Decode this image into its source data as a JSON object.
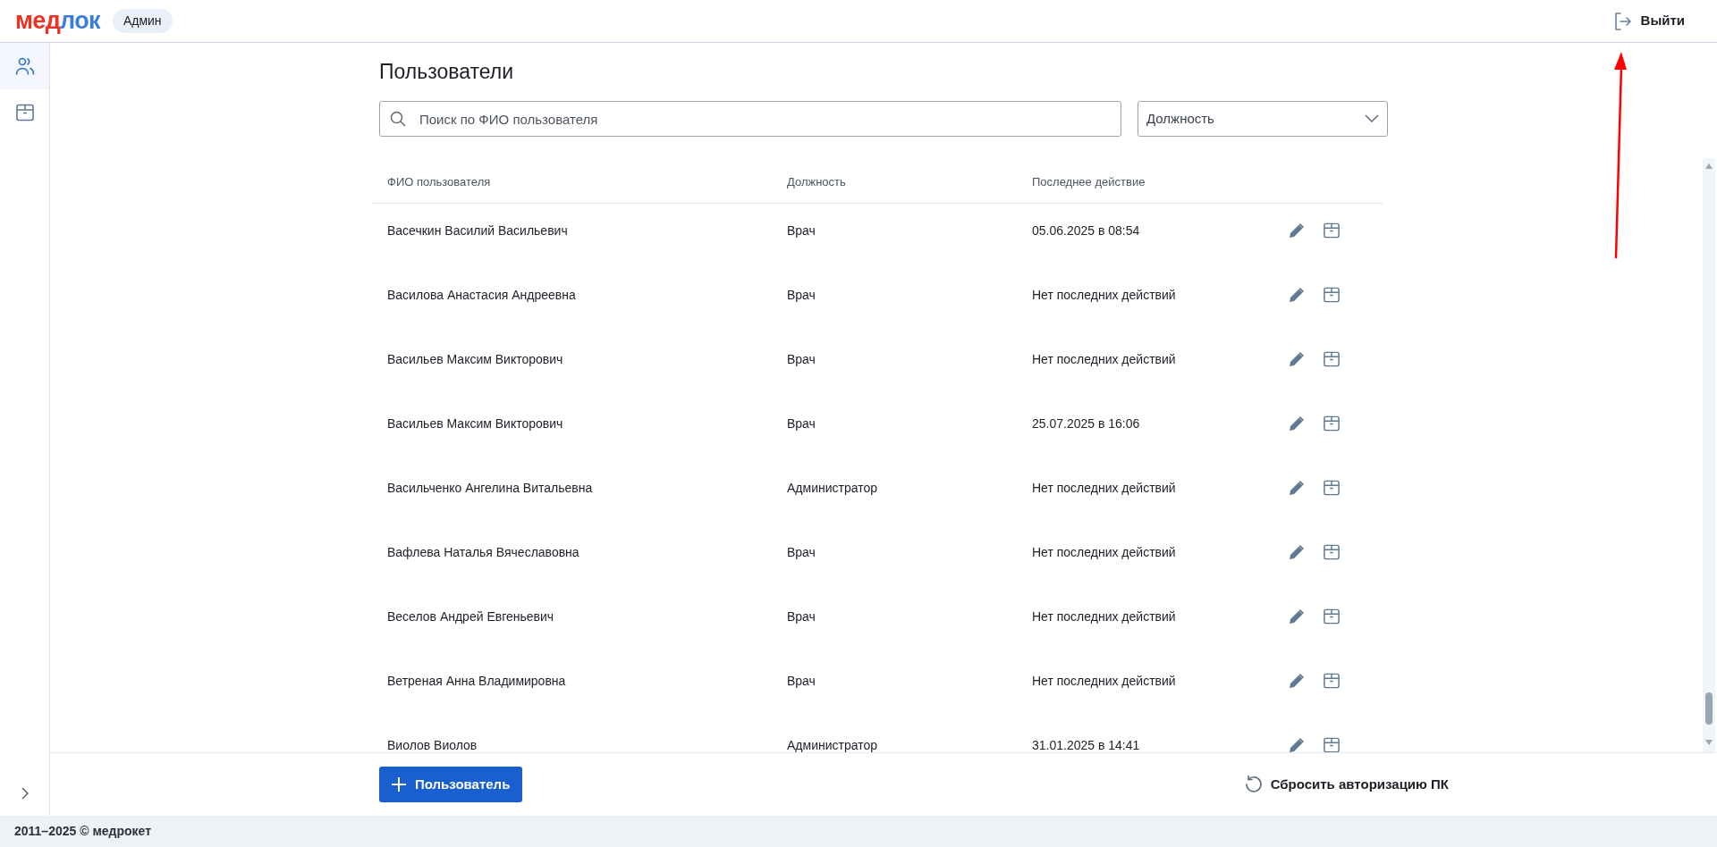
{
  "header": {
    "logo": [
      {
        "text": "мед",
        "color": "#ee3124"
      },
      {
        "text": "лок",
        "color": "#3b7ddd"
      }
    ],
    "role_badge": "Админ",
    "logout": "Выйти"
  },
  "sidebar": {
    "items": [
      {
        "kind": "users",
        "selected": true
      },
      {
        "kind": "box",
        "selected": false
      }
    ]
  },
  "page_title": "Пользователи",
  "search": {
    "placeholder": "Поиск по ФИО пользователя"
  },
  "position_filter": {
    "placeholder": "Должность"
  },
  "table": {
    "columns": [
      "ФИО пользователя",
      "Должность",
      "Последнее действие"
    ],
    "rows": [
      {
        "name": "Васечкин Василий Васильевич",
        "position": "Врач",
        "last_action": "05.06.2025 в 08:54"
      },
      {
        "name": "Василова Анастасия Андреевна",
        "position": "Врач",
        "last_action": "Нет последних действий"
      },
      {
        "name": "Васильев Максим Викторович",
        "position": "Врач",
        "last_action": "Нет последних действий"
      },
      {
        "name": "Васильев Максим Викторович",
        "position": "Врач",
        "last_action": "25.07.2025 в 16:06"
      },
      {
        "name": "Васильченко Ангелина Витальевна",
        "position": "Администратор",
        "last_action": "Нет последних действий"
      },
      {
        "name": "Вафлева Наталья Вячеславовна",
        "position": "Врач",
        "last_action": "Нет последних действий"
      },
      {
        "name": "Веселов Андрей Евгеньевич",
        "position": "Врач",
        "last_action": "Нет последних действий"
      },
      {
        "name": "Ветреная Анна Владимировна",
        "position": "Врач",
        "last_action": "Нет последних действий"
      },
      {
        "name": "Виолов Виолов",
        "position": "Администратор",
        "last_action": "31.01.2025 в 14:41"
      }
    ]
  },
  "add_button": "Пользователь",
  "reset_button": "Сбросить авторизацию ПК",
  "footer": "2011–2025 © медрокет"
}
